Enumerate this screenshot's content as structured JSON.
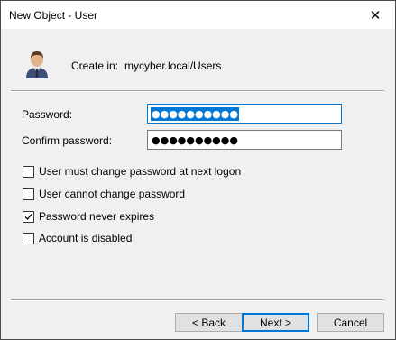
{
  "window": {
    "title": "New Object - User",
    "close_glyph": "✕"
  },
  "header": {
    "icon": "user-icon",
    "create_in_label": "Create in:",
    "create_in_path": "mycyber.local/Users"
  },
  "form": {
    "password_label": "Password:",
    "password_value": "●●●●●●●●●●",
    "confirm_label": "Confirm password:",
    "confirm_value": "●●●●●●●●●●"
  },
  "options": [
    {
      "label": "User must change password at next logon",
      "checked": false
    },
    {
      "label": "User cannot change password",
      "checked": false
    },
    {
      "label": "Password never expires",
      "checked": true
    },
    {
      "label": "Account is disabled",
      "checked": false
    }
  ],
  "buttons": {
    "back": "< Back",
    "next": "Next >",
    "cancel": "Cancel"
  },
  "colors": {
    "focus_accent": "#0078d7",
    "dialog_background": "#f0f0f0"
  }
}
